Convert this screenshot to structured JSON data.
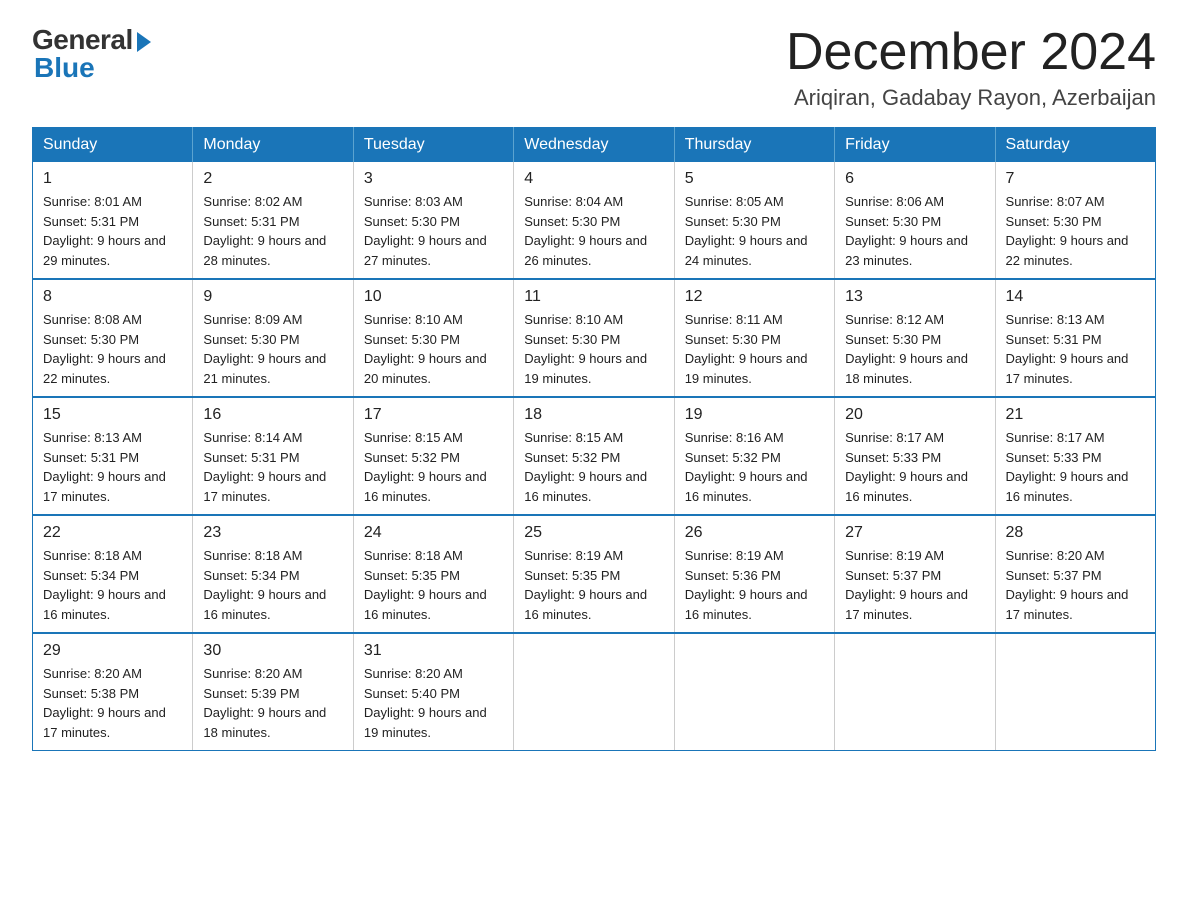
{
  "logo": {
    "general": "General",
    "blue": "Blue"
  },
  "title": "December 2024",
  "location": "Ariqiran, Gadabay Rayon, Azerbaijan",
  "days_header": [
    "Sunday",
    "Monday",
    "Tuesday",
    "Wednesday",
    "Thursday",
    "Friday",
    "Saturday"
  ],
  "weeks": [
    [
      {
        "day": "1",
        "sunrise": "Sunrise: 8:01 AM",
        "sunset": "Sunset: 5:31 PM",
        "daylight": "Daylight: 9 hours and 29 minutes."
      },
      {
        "day": "2",
        "sunrise": "Sunrise: 8:02 AM",
        "sunset": "Sunset: 5:31 PM",
        "daylight": "Daylight: 9 hours and 28 minutes."
      },
      {
        "day": "3",
        "sunrise": "Sunrise: 8:03 AM",
        "sunset": "Sunset: 5:30 PM",
        "daylight": "Daylight: 9 hours and 27 minutes."
      },
      {
        "day": "4",
        "sunrise": "Sunrise: 8:04 AM",
        "sunset": "Sunset: 5:30 PM",
        "daylight": "Daylight: 9 hours and 26 minutes."
      },
      {
        "day": "5",
        "sunrise": "Sunrise: 8:05 AM",
        "sunset": "Sunset: 5:30 PM",
        "daylight": "Daylight: 9 hours and 24 minutes."
      },
      {
        "day": "6",
        "sunrise": "Sunrise: 8:06 AM",
        "sunset": "Sunset: 5:30 PM",
        "daylight": "Daylight: 9 hours and 23 minutes."
      },
      {
        "day": "7",
        "sunrise": "Sunrise: 8:07 AM",
        "sunset": "Sunset: 5:30 PM",
        "daylight": "Daylight: 9 hours and 22 minutes."
      }
    ],
    [
      {
        "day": "8",
        "sunrise": "Sunrise: 8:08 AM",
        "sunset": "Sunset: 5:30 PM",
        "daylight": "Daylight: 9 hours and 22 minutes."
      },
      {
        "day": "9",
        "sunrise": "Sunrise: 8:09 AM",
        "sunset": "Sunset: 5:30 PM",
        "daylight": "Daylight: 9 hours and 21 minutes."
      },
      {
        "day": "10",
        "sunrise": "Sunrise: 8:10 AM",
        "sunset": "Sunset: 5:30 PM",
        "daylight": "Daylight: 9 hours and 20 minutes."
      },
      {
        "day": "11",
        "sunrise": "Sunrise: 8:10 AM",
        "sunset": "Sunset: 5:30 PM",
        "daylight": "Daylight: 9 hours and 19 minutes."
      },
      {
        "day": "12",
        "sunrise": "Sunrise: 8:11 AM",
        "sunset": "Sunset: 5:30 PM",
        "daylight": "Daylight: 9 hours and 19 minutes."
      },
      {
        "day": "13",
        "sunrise": "Sunrise: 8:12 AM",
        "sunset": "Sunset: 5:30 PM",
        "daylight": "Daylight: 9 hours and 18 minutes."
      },
      {
        "day": "14",
        "sunrise": "Sunrise: 8:13 AM",
        "sunset": "Sunset: 5:31 PM",
        "daylight": "Daylight: 9 hours and 17 minutes."
      }
    ],
    [
      {
        "day": "15",
        "sunrise": "Sunrise: 8:13 AM",
        "sunset": "Sunset: 5:31 PM",
        "daylight": "Daylight: 9 hours and 17 minutes."
      },
      {
        "day": "16",
        "sunrise": "Sunrise: 8:14 AM",
        "sunset": "Sunset: 5:31 PM",
        "daylight": "Daylight: 9 hours and 17 minutes."
      },
      {
        "day": "17",
        "sunrise": "Sunrise: 8:15 AM",
        "sunset": "Sunset: 5:32 PM",
        "daylight": "Daylight: 9 hours and 16 minutes."
      },
      {
        "day": "18",
        "sunrise": "Sunrise: 8:15 AM",
        "sunset": "Sunset: 5:32 PM",
        "daylight": "Daylight: 9 hours and 16 minutes."
      },
      {
        "day": "19",
        "sunrise": "Sunrise: 8:16 AM",
        "sunset": "Sunset: 5:32 PM",
        "daylight": "Daylight: 9 hours and 16 minutes."
      },
      {
        "day": "20",
        "sunrise": "Sunrise: 8:17 AM",
        "sunset": "Sunset: 5:33 PM",
        "daylight": "Daylight: 9 hours and 16 minutes."
      },
      {
        "day": "21",
        "sunrise": "Sunrise: 8:17 AM",
        "sunset": "Sunset: 5:33 PM",
        "daylight": "Daylight: 9 hours and 16 minutes."
      }
    ],
    [
      {
        "day": "22",
        "sunrise": "Sunrise: 8:18 AM",
        "sunset": "Sunset: 5:34 PM",
        "daylight": "Daylight: 9 hours and 16 minutes."
      },
      {
        "day": "23",
        "sunrise": "Sunrise: 8:18 AM",
        "sunset": "Sunset: 5:34 PM",
        "daylight": "Daylight: 9 hours and 16 minutes."
      },
      {
        "day": "24",
        "sunrise": "Sunrise: 8:18 AM",
        "sunset": "Sunset: 5:35 PM",
        "daylight": "Daylight: 9 hours and 16 minutes."
      },
      {
        "day": "25",
        "sunrise": "Sunrise: 8:19 AM",
        "sunset": "Sunset: 5:35 PM",
        "daylight": "Daylight: 9 hours and 16 minutes."
      },
      {
        "day": "26",
        "sunrise": "Sunrise: 8:19 AM",
        "sunset": "Sunset: 5:36 PM",
        "daylight": "Daylight: 9 hours and 16 minutes."
      },
      {
        "day": "27",
        "sunrise": "Sunrise: 8:19 AM",
        "sunset": "Sunset: 5:37 PM",
        "daylight": "Daylight: 9 hours and 17 minutes."
      },
      {
        "day": "28",
        "sunrise": "Sunrise: 8:20 AM",
        "sunset": "Sunset: 5:37 PM",
        "daylight": "Daylight: 9 hours and 17 minutes."
      }
    ],
    [
      {
        "day": "29",
        "sunrise": "Sunrise: 8:20 AM",
        "sunset": "Sunset: 5:38 PM",
        "daylight": "Daylight: 9 hours and 17 minutes."
      },
      {
        "day": "30",
        "sunrise": "Sunrise: 8:20 AM",
        "sunset": "Sunset: 5:39 PM",
        "daylight": "Daylight: 9 hours and 18 minutes."
      },
      {
        "day": "31",
        "sunrise": "Sunrise: 8:20 AM",
        "sunset": "Sunset: 5:40 PM",
        "daylight": "Daylight: 9 hours and 19 minutes."
      },
      null,
      null,
      null,
      null
    ]
  ]
}
